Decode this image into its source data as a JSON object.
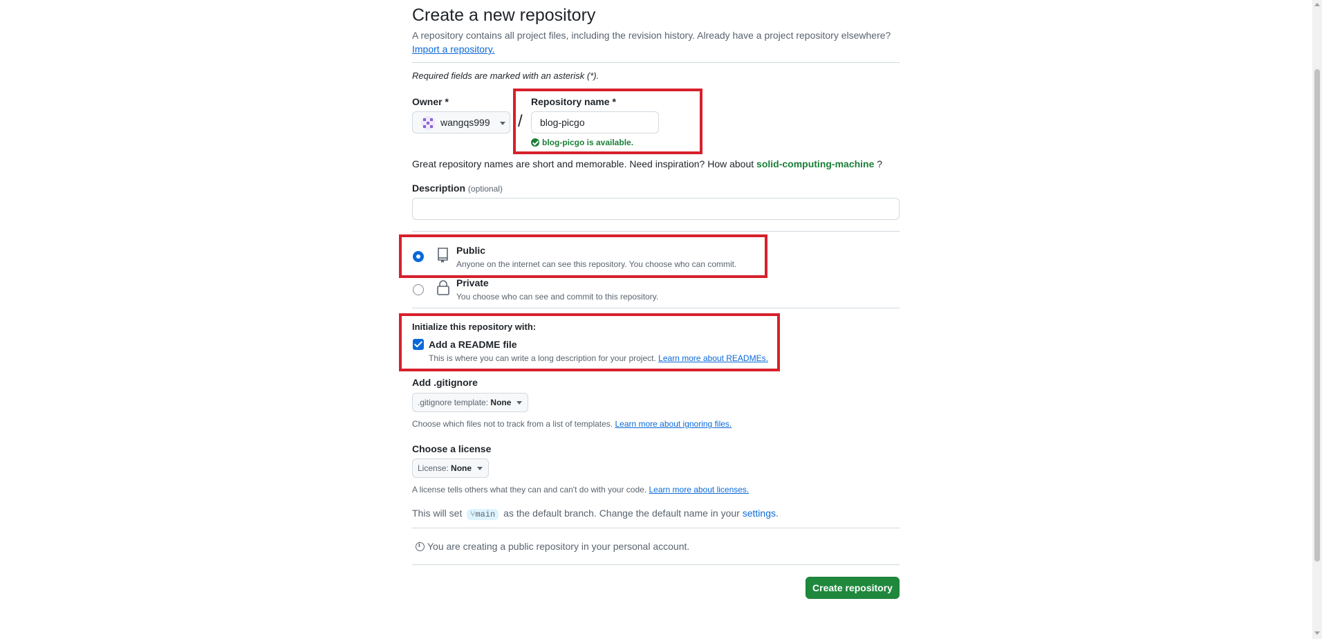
{
  "page": {
    "title": "Create a new repository",
    "subtitle": "A repository contains all project files, including the revision history. Already have a project repository elsewhere?",
    "import_link": "Import a repository.",
    "required_note": "Required fields are marked with an asterisk (*)."
  },
  "owner": {
    "label": "Owner *",
    "value": "wangqs999"
  },
  "repo_name": {
    "label": "Repository name *",
    "value": "blog-picgo",
    "availability": "blog-picgo is available."
  },
  "name_hint": {
    "prefix": "Great repository names are short and memorable. Need inspiration? How about",
    "suggestion": "solid-computing-machine",
    "suffix": "?"
  },
  "description": {
    "label": "Description",
    "optional": "(optional)",
    "value": ""
  },
  "visibility": {
    "public": {
      "title": "Public",
      "desc": "Anyone on the internet can see this repository. You choose who can commit.",
      "selected": true
    },
    "private": {
      "title": "Private",
      "desc": "You choose who can see and commit to this repository.",
      "selected": false
    }
  },
  "init": {
    "heading": "Initialize this repository with:",
    "readme_label": "Add a README file",
    "readme_checked": true,
    "readme_desc": "This is where you can write a long description for your project.",
    "readme_link": "Learn more about READMEs."
  },
  "gitignore": {
    "heading": "Add .gitignore",
    "button_prefix": ".gitignore template:",
    "button_value": "None",
    "desc": "Choose which files not to track from a list of templates.",
    "link": "Learn more about ignoring files."
  },
  "license": {
    "heading": "Choose a license",
    "button_prefix": "License:",
    "button_value": "None",
    "desc": "A license tells others what they can and can't do with your code.",
    "link": "Learn more about licenses."
  },
  "branch": {
    "prefix": "This will set",
    "name": "main",
    "middle": "as the default branch. Change the default name in your",
    "link": "settings",
    "suffix": "."
  },
  "info": {
    "text": "You are creating a public repository in your personal account."
  },
  "actions": {
    "create": "Create repository"
  },
  "colors": {
    "highlight": "#d7202c",
    "primary_button": "#1f883d",
    "success_text": "#1a7f37",
    "link": "#0969da"
  }
}
